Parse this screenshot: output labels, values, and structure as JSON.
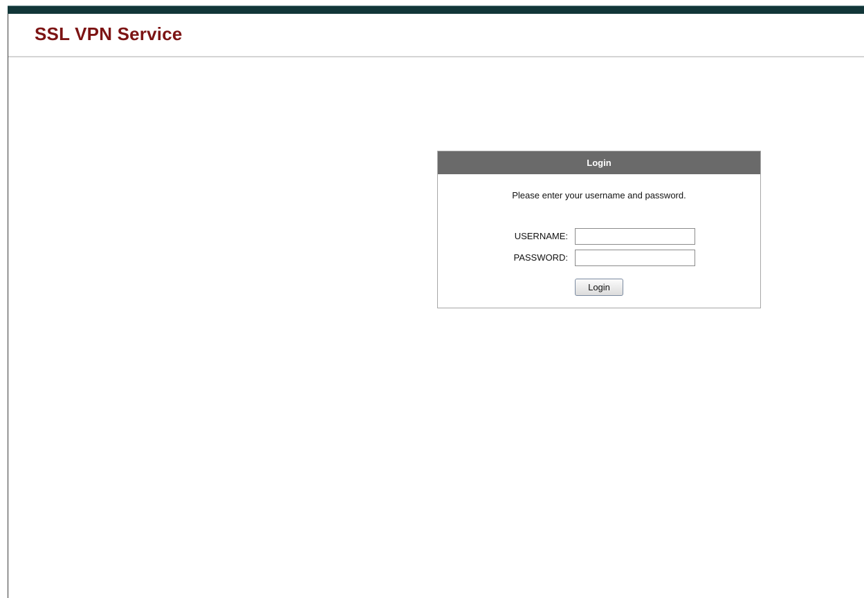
{
  "header": {
    "title": "SSL VPN Service"
  },
  "login": {
    "panel_title": "Login",
    "instruction": "Please enter your username and password.",
    "username_label": "USERNAME:",
    "username_value": "",
    "password_label": "PASSWORD:",
    "password_value": "",
    "submit_label": "Login"
  },
  "colors": {
    "top_bar": "#123638",
    "brand_title": "#7c1414",
    "panel_header": "#6a6a6a"
  }
}
